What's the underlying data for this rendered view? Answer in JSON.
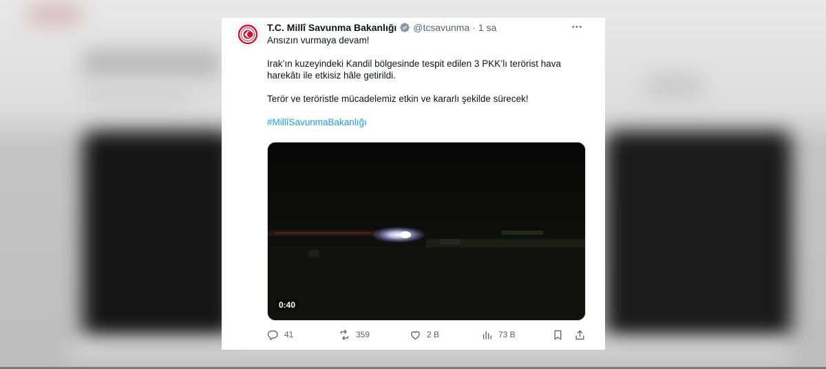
{
  "tweet": {
    "display_name": "T.C. Millî Savunma Bakanlığı",
    "handle": "@tcsavunma",
    "separator": "·",
    "time": "1 sa",
    "lines": [
      "Ansızın vurmaya devam!",
      "Irak’ın kuzeyindeki Kandil bölgesinde tespit edilen 3 PKK’lı terörist hava",
      "harekâtı ile etkisiz hâle getirildi.",
      "Terör ve teröristle mücadelemiz etkin ve kararlı şekilde sürecek!"
    ],
    "hashtag": "#MillîSavunmaBakanlığı",
    "video_duration": "0:40",
    "stats": {
      "replies": "41",
      "reposts": "359",
      "likes": "2 B",
      "views": "73 B"
    }
  },
  "icons": {
    "avatar": "ministry-emblem-icon",
    "verified": "verified-badge-icon",
    "more": "more-icon",
    "reply": "reply-icon",
    "repost": "repost-icon",
    "like": "like-icon",
    "views": "views-icon",
    "bookmark": "bookmark-icon",
    "share": "share-icon"
  },
  "colors": {
    "accent": "#1d9bf0",
    "text": "#0f1419",
    "muted": "#536471",
    "emblem_red": "#d0122c"
  }
}
